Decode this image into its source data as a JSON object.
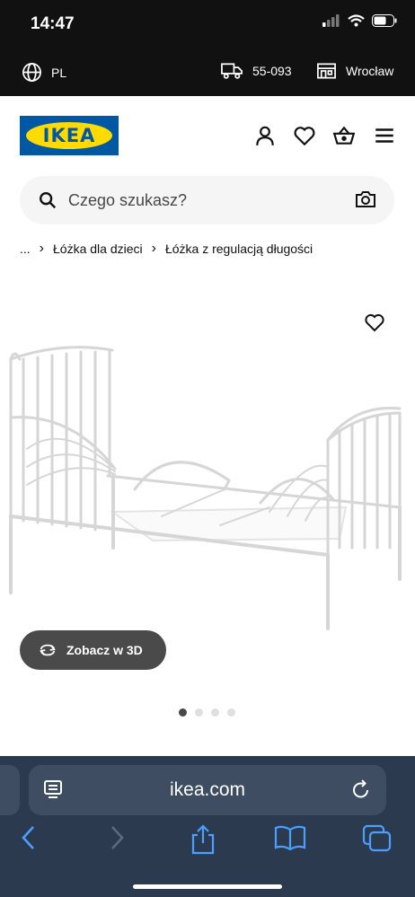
{
  "status_bar": {
    "time": "14:47"
  },
  "top_bar": {
    "language": "PL",
    "postal_code": "55-093",
    "store": "Wrocław"
  },
  "header": {
    "logo_text": "IKEA"
  },
  "search": {
    "placeholder": "Czego szukasz?"
  },
  "breadcrumb": {
    "ellipsis": "...",
    "items": [
      "Łóżka dla dzieci",
      "Łóżka z regulacją długości"
    ]
  },
  "product": {
    "view_3d_label": "Zobacz w 3D",
    "carousel": {
      "count": 4,
      "active": 1
    }
  },
  "browser": {
    "url": "ikea.com"
  },
  "icons": [
    "globe-icon",
    "truck-icon",
    "store-icon",
    "user-icon",
    "heart-icon",
    "cart-icon",
    "menu-icon",
    "search-icon",
    "camera-icon",
    "rotate-3d-icon",
    "tabs-icon",
    "reload-icon",
    "back-icon",
    "forward-icon",
    "share-icon",
    "bookmarks-icon",
    "tab-switcher-icon"
  ]
}
